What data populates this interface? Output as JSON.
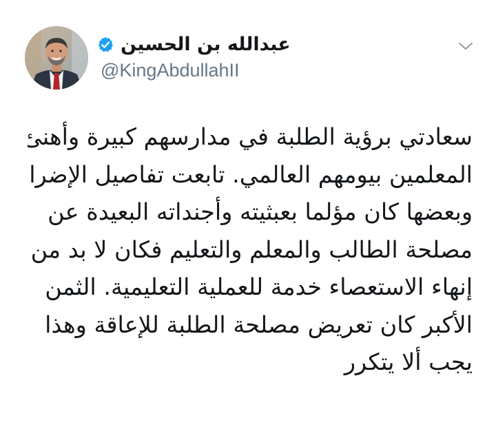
{
  "tweet": {
    "author": {
      "display_name": "عبدالله بن الحسين",
      "handle": "@KingAbdullahII",
      "verified": true,
      "avatar_icon": "profile-photo"
    },
    "menu_icon": "chevron-down-icon",
    "text_lines": [
      "سعادتي برؤية الطلبة في مدارسهم كبيرة وأهنئ",
      "المعلمين بيومهم العالمي. تابعت تفاصيل الإضراب",
      "وبعضها كان مؤلما بعبثيته وأجنداته البعيدة عن",
      "مصلحة الطالب والمعلم والتعليم فكان لا بد من",
      "إنهاء الاستعصاء خدمة للعملية التعليمية. الثمن",
      "الأكبر كان تعريض مصلحة الطلبة للإعاقة وهذا",
      "يجب ألا يتكرر"
    ]
  },
  "colors": {
    "text": "#14171a",
    "secondary": "#657786",
    "verified_badge": "#1da1f2",
    "background": "#ffffff"
  }
}
